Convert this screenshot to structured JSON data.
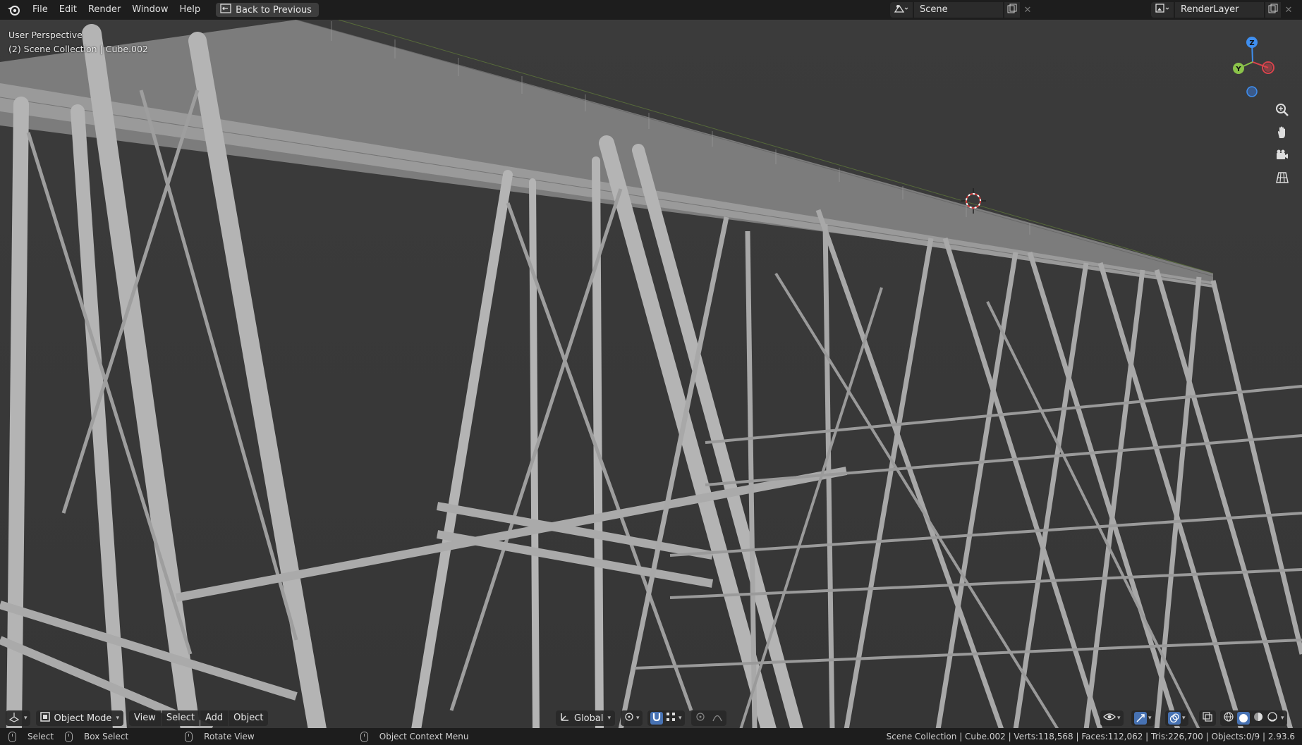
{
  "menu": {
    "items": [
      "File",
      "Edit",
      "Render",
      "Window",
      "Help"
    ],
    "back_label": "Back to Previous"
  },
  "scene": {
    "name": "Scene"
  },
  "render_layer": {
    "name": "RenderLayer"
  },
  "viewport": {
    "perspective": "User Perspective",
    "collection_info": "(2) Scene Collection | Cube.002",
    "gizmo_axes": {
      "z": "Z",
      "y": "Y"
    }
  },
  "header": {
    "mode": "Object Mode",
    "menus": [
      "View",
      "Select",
      "Add",
      "Object"
    ],
    "orientation": "Global"
  },
  "status": {
    "select": "Select",
    "box_select": "Box Select",
    "rotate_view": "Rotate View",
    "context_menu": "Object Context Menu",
    "stats": "Scene Collection | Cube.002 | Verts:118,568 | Faces:112,062 | Tris:226,700 | Objects:0/9 | 2.93.6"
  },
  "colors": {
    "bg": "#3a3a3a",
    "topbar": "#1d1d1d",
    "x_axis": "#d9434c",
    "y_axis": "#8bc34a",
    "z_axis": "#3f8ff0",
    "active_blue": "#4772b3"
  }
}
